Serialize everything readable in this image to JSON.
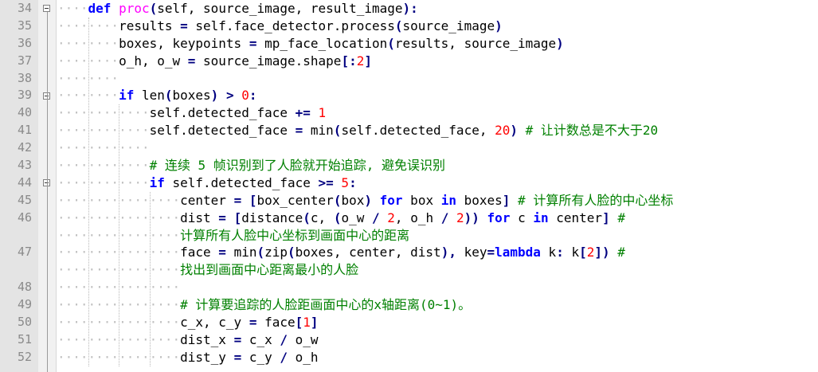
{
  "editor": {
    "lines": [
      {
        "n": "34",
        "fold": true,
        "indent": 1,
        "tokens": [
          {
            "t": "def",
            "c": "kw"
          },
          {
            "t": " ",
            "c": ""
          },
          {
            "t": "proc",
            "c": "fn"
          },
          {
            "t": "(",
            "c": "op"
          },
          {
            "t": "self, source_image, result_image",
            "c": ""
          },
          {
            "t": "):",
            "c": "op"
          }
        ]
      },
      {
        "n": "35",
        "indent": 2,
        "tokens": [
          {
            "t": "results ",
            "c": ""
          },
          {
            "t": "=",
            "c": "op"
          },
          {
            "t": " self.face_detector.process",
            "c": ""
          },
          {
            "t": "(",
            "c": "op"
          },
          {
            "t": "source_image",
            "c": ""
          },
          {
            "t": ")",
            "c": "op"
          }
        ]
      },
      {
        "n": "36",
        "indent": 2,
        "tokens": [
          {
            "t": "boxes, keypoints ",
            "c": ""
          },
          {
            "t": "=",
            "c": "op"
          },
          {
            "t": " mp_face_location",
            "c": ""
          },
          {
            "t": "(",
            "c": "op"
          },
          {
            "t": "results, source_image",
            "c": ""
          },
          {
            "t": ")",
            "c": "op"
          }
        ]
      },
      {
        "n": "37",
        "indent": 2,
        "tokens": [
          {
            "t": "o_h, o_w ",
            "c": ""
          },
          {
            "t": "=",
            "c": "op"
          },
          {
            "t": " source_image.shape",
            "c": ""
          },
          {
            "t": "[:",
            "c": "op"
          },
          {
            "t": "2",
            "c": "num"
          },
          {
            "t": "]",
            "c": "op"
          }
        ]
      },
      {
        "n": "38",
        "indent": 2,
        "tokens": []
      },
      {
        "n": "39",
        "fold": true,
        "indent": 2,
        "tokens": [
          {
            "t": "if",
            "c": "kw"
          },
          {
            "t": " len",
            "c": ""
          },
          {
            "t": "(",
            "c": "op"
          },
          {
            "t": "boxes",
            "c": ""
          },
          {
            "t": ")",
            "c": "op"
          },
          {
            "t": " ",
            "c": ""
          },
          {
            "t": ">",
            "c": "op"
          },
          {
            "t": " ",
            "c": ""
          },
          {
            "t": "0",
            "c": "num"
          },
          {
            "t": ":",
            "c": "op"
          }
        ]
      },
      {
        "n": "40",
        "indent": 3,
        "tokens": [
          {
            "t": "self.detected_face ",
            "c": ""
          },
          {
            "t": "+=",
            "c": "op"
          },
          {
            "t": " ",
            "c": ""
          },
          {
            "t": "1",
            "c": "num"
          }
        ]
      },
      {
        "n": "41",
        "indent": 3,
        "tokens": [
          {
            "t": "self.detected_face ",
            "c": ""
          },
          {
            "t": "=",
            "c": "op"
          },
          {
            "t": " min",
            "c": ""
          },
          {
            "t": "(",
            "c": "op"
          },
          {
            "t": "self.detected_face, ",
            "c": ""
          },
          {
            "t": "20",
            "c": "num"
          },
          {
            "t": ")",
            "c": "op"
          },
          {
            "t": " # 让计数总是不大于20",
            "c": "cm"
          }
        ]
      },
      {
        "n": "42",
        "indent": 3,
        "tokens": []
      },
      {
        "n": "43",
        "indent": 3,
        "tokens": [
          {
            "t": "# 连续 5 帧识别到了人脸就开始追踪, 避免误识别",
            "c": "cm"
          }
        ]
      },
      {
        "n": "44",
        "fold": true,
        "indent": 3,
        "tokens": [
          {
            "t": "if",
            "c": "kw"
          },
          {
            "t": " self.detected_face ",
            "c": ""
          },
          {
            "t": ">=",
            "c": "op"
          },
          {
            "t": " ",
            "c": ""
          },
          {
            "t": "5",
            "c": "num"
          },
          {
            "t": ":",
            "c": "op"
          }
        ]
      },
      {
        "n": "45",
        "indent": 4,
        "tokens": [
          {
            "t": "center ",
            "c": ""
          },
          {
            "t": "=",
            "c": "op"
          },
          {
            "t": " ",
            "c": ""
          },
          {
            "t": "[",
            "c": "op"
          },
          {
            "t": "box_center",
            "c": ""
          },
          {
            "t": "(",
            "c": "op"
          },
          {
            "t": "box",
            "c": ""
          },
          {
            "t": ")",
            "c": "op"
          },
          {
            "t": " ",
            "c": ""
          },
          {
            "t": "for",
            "c": "kw"
          },
          {
            "t": " box ",
            "c": ""
          },
          {
            "t": "in",
            "c": "kw"
          },
          {
            "t": " boxes",
            "c": ""
          },
          {
            "t": "]",
            "c": "op"
          },
          {
            "t": " # 计算所有人脸的中心坐标",
            "c": "cm"
          }
        ]
      },
      {
        "n": "46",
        "indent": 4,
        "tokens": [
          {
            "t": "dist ",
            "c": ""
          },
          {
            "t": "=",
            "c": "op"
          },
          {
            "t": " ",
            "c": ""
          },
          {
            "t": "[",
            "c": "op"
          },
          {
            "t": "distance",
            "c": ""
          },
          {
            "t": "(",
            "c": "op"
          },
          {
            "t": "c, ",
            "c": ""
          },
          {
            "t": "(",
            "c": "op"
          },
          {
            "t": "o_w ",
            "c": ""
          },
          {
            "t": "/",
            "c": "op"
          },
          {
            "t": " ",
            "c": ""
          },
          {
            "t": "2",
            "c": "num"
          },
          {
            "t": ", o_h ",
            "c": ""
          },
          {
            "t": "/",
            "c": "op"
          },
          {
            "t": " ",
            "c": ""
          },
          {
            "t": "2",
            "c": "num"
          },
          {
            "t": "))",
            "c": "op"
          },
          {
            "t": " ",
            "c": ""
          },
          {
            "t": "for",
            "c": "kw"
          },
          {
            "t": " c ",
            "c": ""
          },
          {
            "t": "in",
            "c": "kw"
          },
          {
            "t": " center",
            "c": ""
          },
          {
            "t": "]",
            "c": "op"
          },
          {
            "t": " #",
            "c": "cm"
          }
        ]
      },
      {
        "n": "",
        "indent": 4,
        "tokens": [
          {
            "t": "计算所有人脸中心坐标到画面中心的距离",
            "c": "cm"
          }
        ]
      },
      {
        "n": "47",
        "indent": 4,
        "tokens": [
          {
            "t": "face ",
            "c": ""
          },
          {
            "t": "=",
            "c": "op"
          },
          {
            "t": " min",
            "c": ""
          },
          {
            "t": "(",
            "c": "op"
          },
          {
            "t": "zip",
            "c": ""
          },
          {
            "t": "(",
            "c": "op"
          },
          {
            "t": "boxes, center, dist",
            "c": ""
          },
          {
            "t": "),",
            "c": "op"
          },
          {
            "t": " key",
            "c": ""
          },
          {
            "t": "=",
            "c": "op"
          },
          {
            "t": "lambda",
            "c": "kw"
          },
          {
            "t": " k",
            "c": ""
          },
          {
            "t": ":",
            "c": "op"
          },
          {
            "t": " k",
            "c": ""
          },
          {
            "t": "[",
            "c": "op"
          },
          {
            "t": "2",
            "c": "num"
          },
          {
            "t": "])",
            "c": "op"
          },
          {
            "t": " #",
            "c": "cm"
          }
        ]
      },
      {
        "n": "",
        "indent": 4,
        "tokens": [
          {
            "t": "找出到画面中心距离最小的人脸",
            "c": "cm"
          }
        ]
      },
      {
        "n": "48",
        "indent": 4,
        "tokens": []
      },
      {
        "n": "49",
        "indent": 4,
        "tokens": [
          {
            "t": "# 计算要追踪的人脸距画面中心的x轴距离(0~1)。",
            "c": "cm"
          }
        ]
      },
      {
        "n": "50",
        "indent": 4,
        "tokens": [
          {
            "t": "c_x, c_y ",
            "c": ""
          },
          {
            "t": "=",
            "c": "op"
          },
          {
            "t": " face",
            "c": ""
          },
          {
            "t": "[",
            "c": "op"
          },
          {
            "t": "1",
            "c": "num"
          },
          {
            "t": "]",
            "c": "op"
          }
        ]
      },
      {
        "n": "51",
        "indent": 4,
        "tokens": [
          {
            "t": "dist_x ",
            "c": ""
          },
          {
            "t": "=",
            "c": "op"
          },
          {
            "t": " c_x ",
            "c": ""
          },
          {
            "t": "/",
            "c": "op"
          },
          {
            "t": " o_w",
            "c": ""
          }
        ]
      },
      {
        "n": "52",
        "indent": 4,
        "tokens": [
          {
            "t": "dist_y ",
            "c": ""
          },
          {
            "t": "=",
            "c": "op"
          },
          {
            "t": " c_y ",
            "c": ""
          },
          {
            "t": "/",
            "c": "op"
          },
          {
            "t": " o_h",
            "c": ""
          }
        ]
      }
    ]
  }
}
